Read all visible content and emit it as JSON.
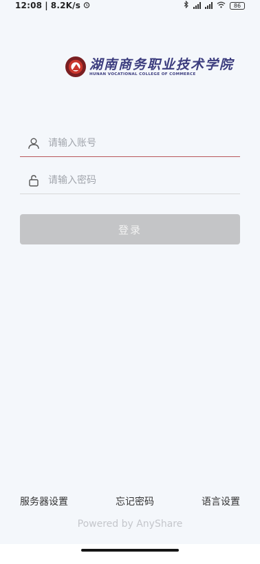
{
  "status_bar": {
    "time": "12:08",
    "speed": "8.2K/s",
    "battery": "86"
  },
  "logo": {
    "name_cn": "湖南商务职业技术学院",
    "name_en": "HUNAN VOCATIONAL COLLEGE OF COMMERCE"
  },
  "form": {
    "account_placeholder": "请输入账号",
    "password_placeholder": "请输入密码",
    "login_label": "登录"
  },
  "footer": {
    "server_settings": "服务器设置",
    "forgot_password": "忘记密码",
    "language_settings": "语言设置",
    "powered_by": "Powered by AnyShare"
  },
  "colors": {
    "active_underline": "#b7565a",
    "button_disabled": "#c4c5c7",
    "brand": "#3b3c7e"
  }
}
